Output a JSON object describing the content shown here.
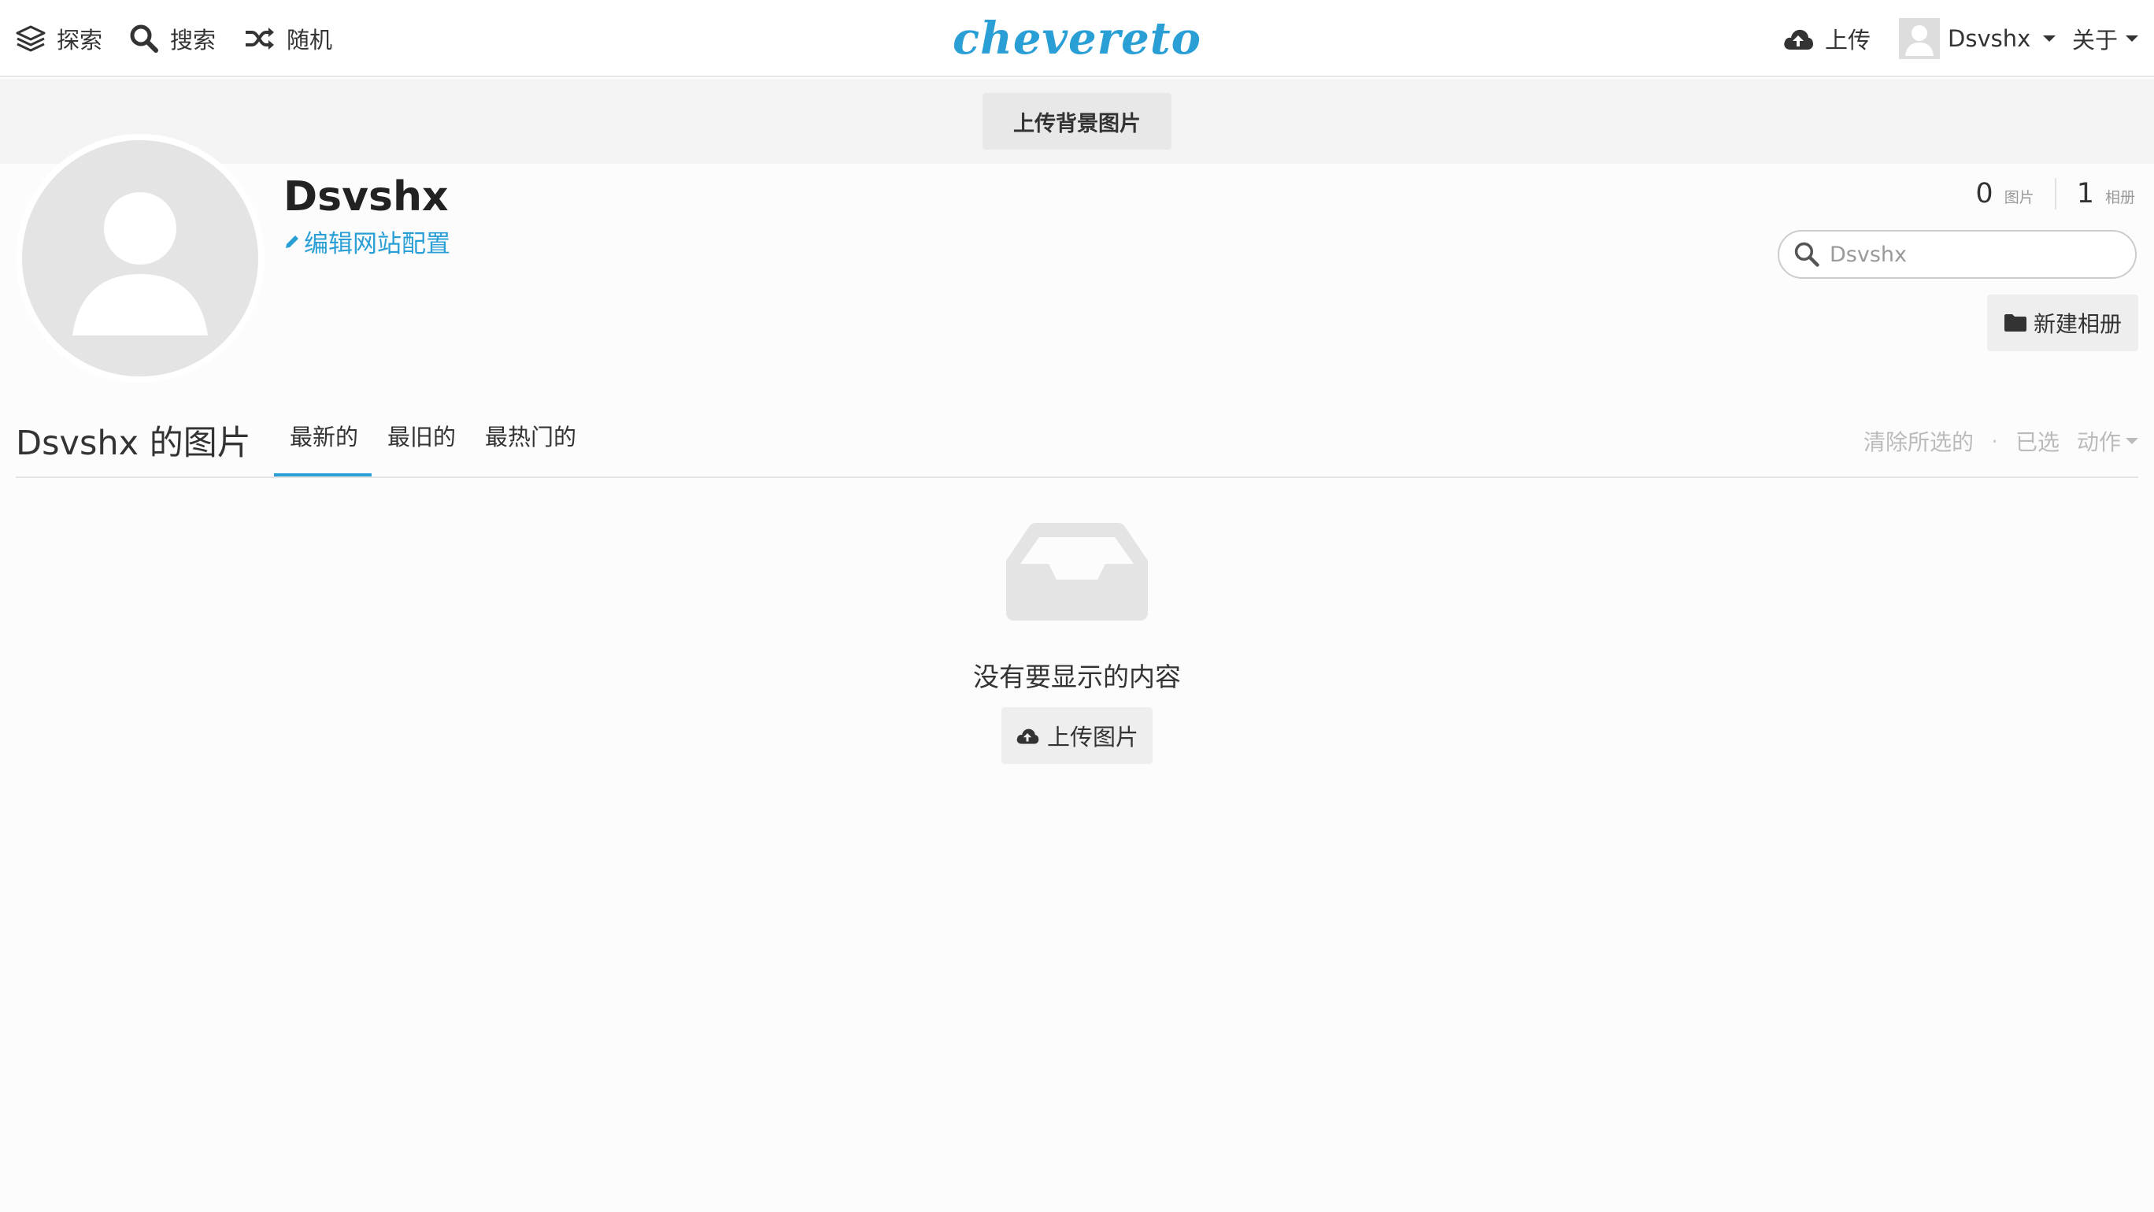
{
  "topbar": {
    "nav": [
      {
        "label": "探索",
        "icon": "layers-icon"
      },
      {
        "label": "搜索",
        "icon": "search-icon"
      },
      {
        "label": "随机",
        "icon": "shuffle-icon"
      }
    ],
    "logo_text": "chevereto",
    "upload_label": "上传",
    "user_name": "Dsvshx",
    "about_label": "关于"
  },
  "cover": {
    "upload_bg_label": "上传背景图片"
  },
  "profile": {
    "name": "Dsvshx",
    "edit_label": "编辑网站配置",
    "stats": {
      "images_count": "0",
      "images_label": "图片",
      "albums_count": "1",
      "albums_label": "相册"
    },
    "search_placeholder": "Dsvshx",
    "new_album_label": "新建相册"
  },
  "listing": {
    "title": "Dsvshx 的图片",
    "tabs": [
      {
        "label": "最新的",
        "active": true
      },
      {
        "label": "最旧的",
        "active": false
      },
      {
        "label": "最热门的",
        "active": false
      }
    ],
    "clear_selection_label": "清除所选的",
    "separator": "·",
    "selected_label": "已选",
    "action_label": "动作"
  },
  "empty_state": {
    "message": "没有要显示的内容",
    "upload_button_label": "上传图片"
  },
  "colors": {
    "accent": "#2a9fd6",
    "muted": "#bbbbbb"
  }
}
